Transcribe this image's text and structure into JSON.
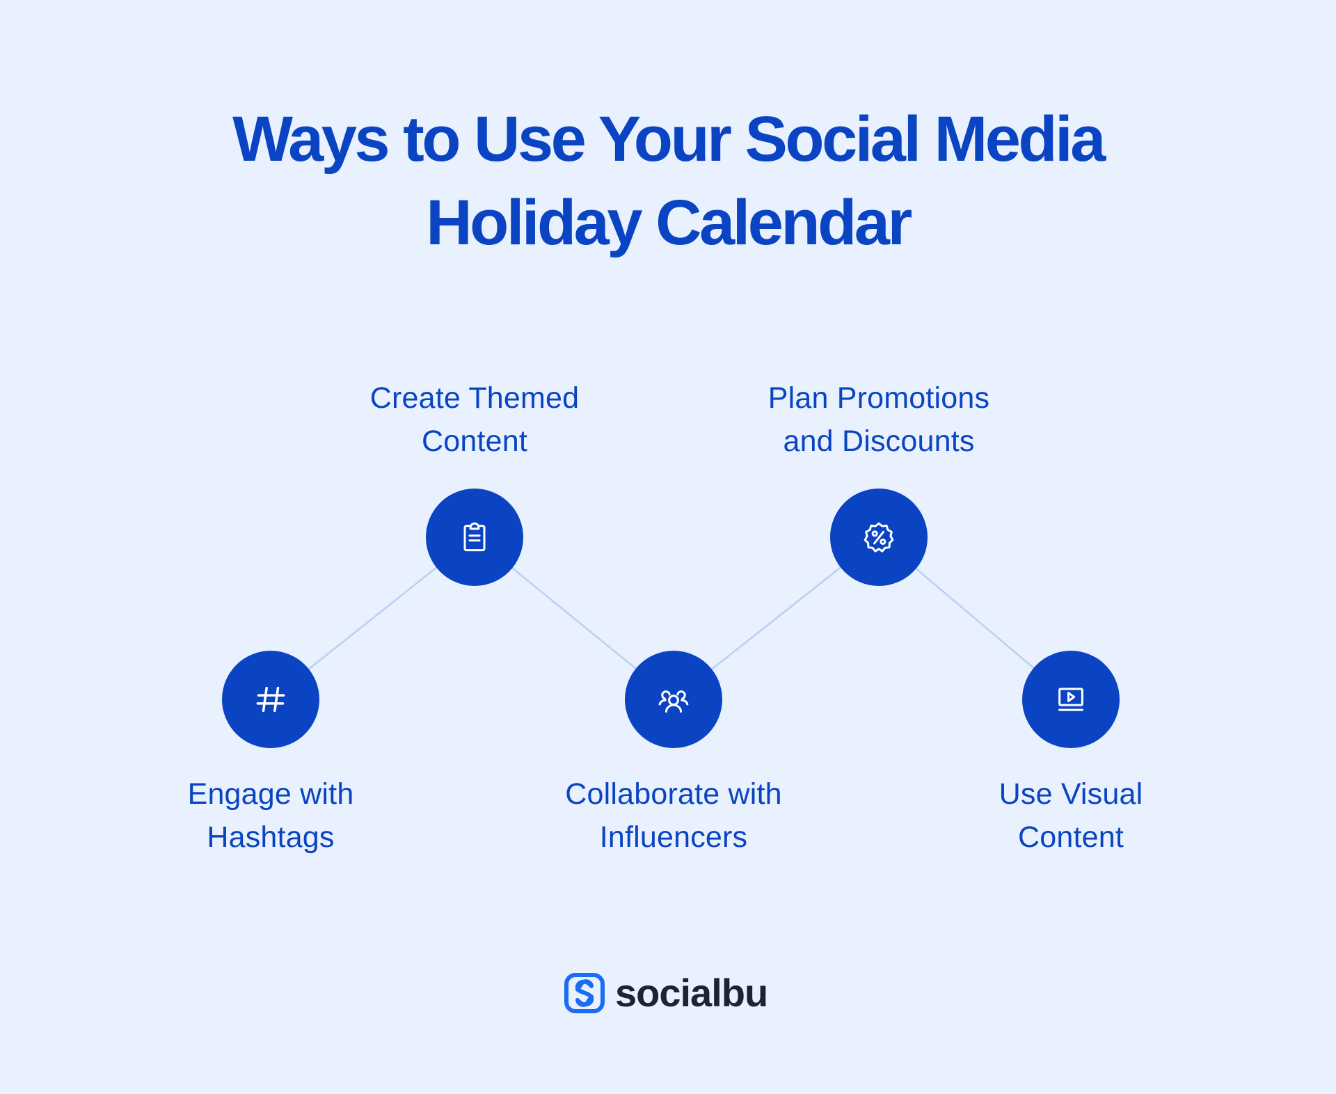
{
  "title": {
    "line1": "Ways to Use Your Social Media",
    "line2": "Holiday Calendar"
  },
  "colors": {
    "background": "#e8f1fd",
    "accent": "#0a44c2",
    "connector": "#b9d0f5",
    "icon_stroke": "#ffffff",
    "brand_text": "#1f2230",
    "brand_logo": "#1a6cf5"
  },
  "steps": [
    {
      "id": "hashtags",
      "icon": "hashtag-icon",
      "label_line1": "Engage with",
      "label_line2": "Hashtags",
      "row": "bottom"
    },
    {
      "id": "themed-content",
      "icon": "clipboard-icon",
      "label_line1": "Create Themed",
      "label_line2": "Content",
      "row": "top"
    },
    {
      "id": "influencers",
      "icon": "users-group-icon",
      "label_line1": "Collaborate with",
      "label_line2": "Influencers",
      "row": "bottom"
    },
    {
      "id": "promotions",
      "icon": "discount-badge-icon",
      "label_line1": "Plan Promotions",
      "label_line2": "and Discounts",
      "row": "top"
    },
    {
      "id": "visual-content",
      "icon": "video-screen-icon",
      "label_line1": "Use Visual",
      "label_line2": "Content",
      "row": "bottom"
    }
  ],
  "brand": {
    "name": "socialbu",
    "logo_icon": "socialbu-logo-icon"
  }
}
